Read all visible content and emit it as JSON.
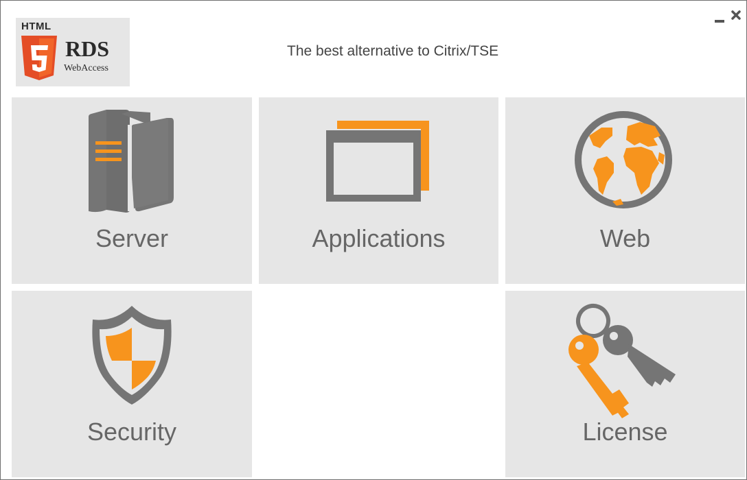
{
  "window": {
    "minimize_icon": "minimize-icon",
    "close_icon": "close-icon"
  },
  "logo": {
    "html_text": "HTML",
    "shield_number": "5",
    "rds_text": "RDS",
    "webaccess_text": "WebAccess"
  },
  "header": {
    "tagline": "The best alternative to Citrix/TSE"
  },
  "tiles": [
    {
      "label": "Server",
      "icon": "server-icon"
    },
    {
      "label": "Applications",
      "icon": "applications-icon"
    },
    {
      "label": "Web",
      "icon": "globe-icon"
    },
    {
      "label": "Security",
      "icon": "shield-icon"
    },
    {
      "label": "License",
      "icon": "keys-icon"
    }
  ],
  "colors": {
    "accent": "#f7941d",
    "icon_gray": "#757575",
    "tile_bg": "#e6e6e6",
    "html5_orange": "#e44d26"
  }
}
